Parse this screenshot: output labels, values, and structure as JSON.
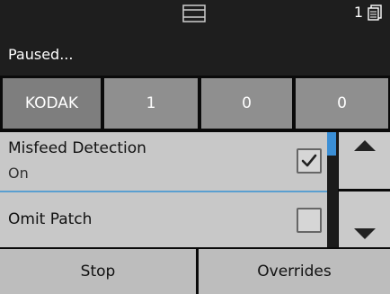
{
  "status": {
    "text": "Paused...",
    "page_count": "1"
  },
  "counters": {
    "brand": "KODAK",
    "values": [
      "1",
      "0",
      "0"
    ]
  },
  "list": {
    "items": [
      {
        "title": "Misfeed Detection",
        "subtitle": "On",
        "checked": true
      },
      {
        "title": "Omit Patch",
        "subtitle": "",
        "checked": false
      }
    ]
  },
  "buttons": {
    "stop": "Stop",
    "overrides": "Overrides"
  },
  "colors": {
    "accent": "#3b8fd6",
    "header": "#1e1e1e",
    "counter": "#8f8f8f"
  }
}
